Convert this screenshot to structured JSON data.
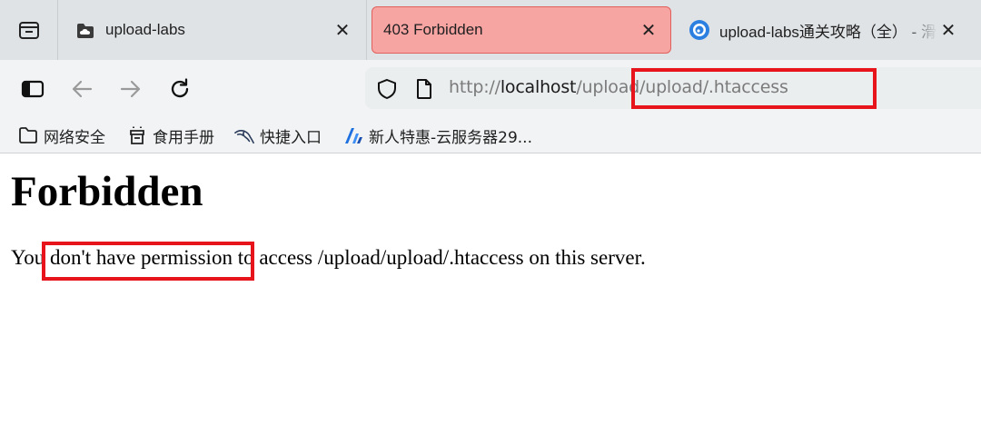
{
  "tabs": [
    {
      "title": "upload-labs",
      "favicon": "cloud-icon",
      "active": false
    },
    {
      "title": "403 Forbidden",
      "favicon": "",
      "active": true
    },
    {
      "title": "upload-labs通关攻略（全） - 滑",
      "favicon": "blog-icon",
      "active": false
    }
  ],
  "toolbar": {
    "url_scheme": "http://",
    "url_host": "localhost",
    "url_path": "/upload/upload/.htaccess"
  },
  "bookmarks": [
    {
      "label": "网络安全",
      "icon": "folder-icon"
    },
    {
      "label": "食用手册",
      "icon": "bag-icon"
    },
    {
      "label": "快捷入口",
      "icon": "kali-dragon-icon"
    },
    {
      "label": "新人特惠-云服务器29...",
      "icon": "cloud-brand-icon"
    }
  ],
  "page": {
    "heading": "Forbidden",
    "message": "You don't have permission to access /upload/upload/.htaccess on this server."
  },
  "colors": {
    "active_tab_bg": "#f7a5a3",
    "annotation": "#e8141b"
  }
}
